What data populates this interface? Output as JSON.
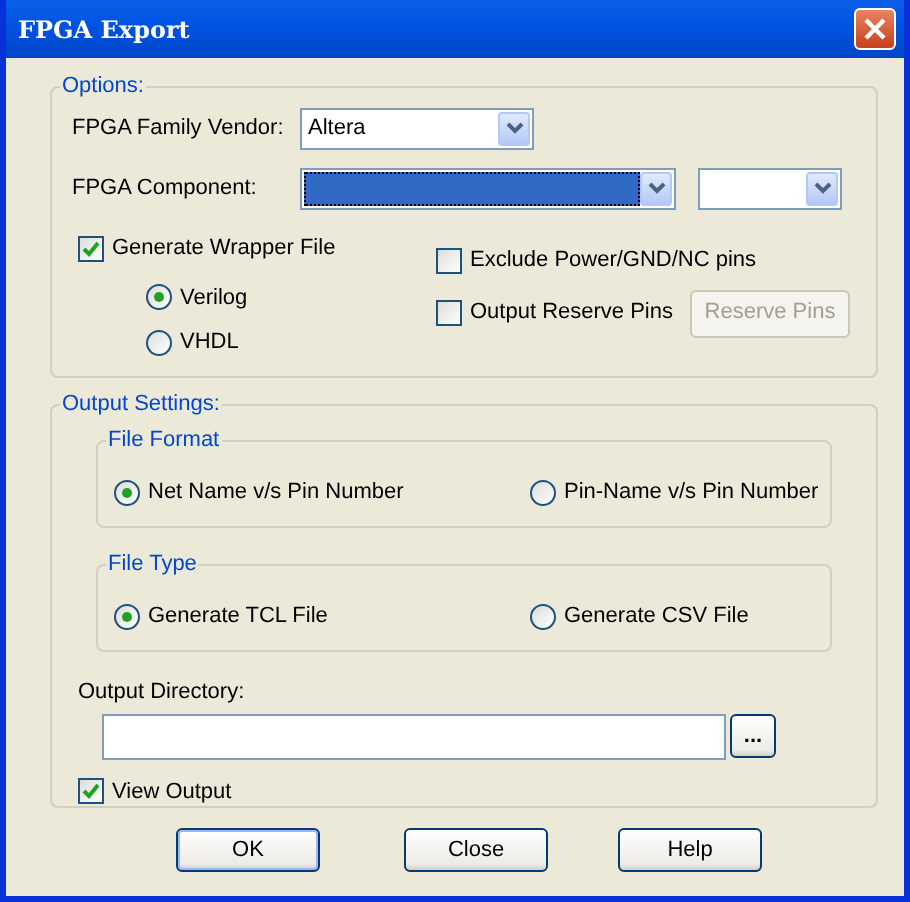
{
  "window": {
    "title": "FPGA Export"
  },
  "options": {
    "legend": "Options:",
    "vendor": {
      "label": "FPGA Family Vendor:",
      "value": "Altera"
    },
    "component": {
      "label": "FPGA Component:",
      "selected": true
    },
    "generate_wrapper": {
      "label": "Generate Wrapper File",
      "checked": true
    },
    "languages": [
      {
        "label": "Verilog",
        "selected": true
      },
      {
        "label": "VHDL",
        "selected": false
      }
    ],
    "exclude_pins": {
      "label": "Exclude Power/GND/NC pins",
      "checked": false
    },
    "output_reserve": {
      "label": "Output Reserve Pins",
      "checked": false
    },
    "reserve_button": {
      "label": "Reserve Pins",
      "disabled": true
    }
  },
  "output_settings": {
    "legend": "Output Settings:",
    "file_format": {
      "legend": "File Format",
      "choices": [
        {
          "label": "Net Name v/s Pin Number",
          "selected": true
        },
        {
          "label": "Pin-Name v/s Pin Number",
          "selected": false
        }
      ]
    },
    "file_type": {
      "legend": "File Type",
      "choices": [
        {
          "label": "Generate TCL File",
          "selected": true
        },
        {
          "label": "Generate CSV File",
          "selected": false
        }
      ]
    },
    "output_directory": {
      "label": "Output Directory:",
      "browse": "..."
    },
    "view_output": {
      "label": "View Output",
      "checked": true
    }
  },
  "buttons": [
    {
      "label": "OK",
      "default": true
    },
    {
      "label": "Close",
      "default": false
    },
    {
      "label": "Help",
      "default": false
    }
  ]
}
